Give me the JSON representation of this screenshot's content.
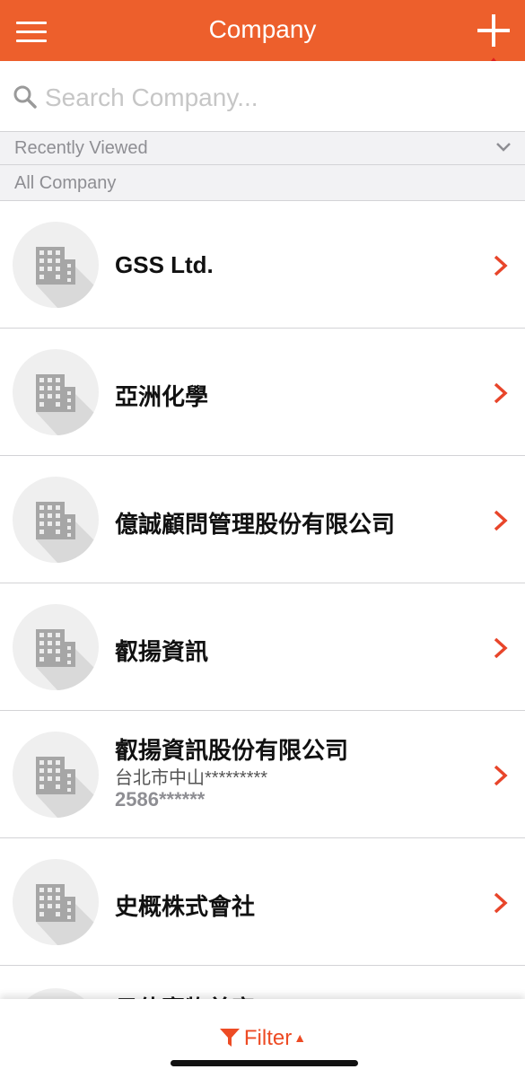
{
  "header": {
    "title": "Company"
  },
  "search": {
    "placeholder": "Search Company..."
  },
  "sections": {
    "recent": "Recently Viewed",
    "all": "All Company"
  },
  "companies": [
    {
      "name": "GSS Ltd."
    },
    {
      "name": "亞洲化學"
    },
    {
      "name": "億誠顧問管理股份有限公司"
    },
    {
      "name": "叡揚資訊"
    },
    {
      "name": "叡揚資訊股份有限公司",
      "address": "台北市中山*********",
      "phone": "2586******"
    },
    {
      "name": "史概株式會社"
    },
    {
      "name": "日佳寵物美容"
    }
  ],
  "footer": {
    "filter_label": "Filter"
  },
  "colors": {
    "accent": "#ed5f2c",
    "chevron": "#e8452a",
    "background": "#ffffff"
  },
  "icons": {
    "menu": "hamburger-icon",
    "add": "plus-icon",
    "annotation": "arrow-up-outline-icon",
    "search": "search-icon",
    "expand": "chevron-down-icon",
    "avatar": "building-icon",
    "row": "chevron-right-icon",
    "filter": "funnel-icon"
  }
}
